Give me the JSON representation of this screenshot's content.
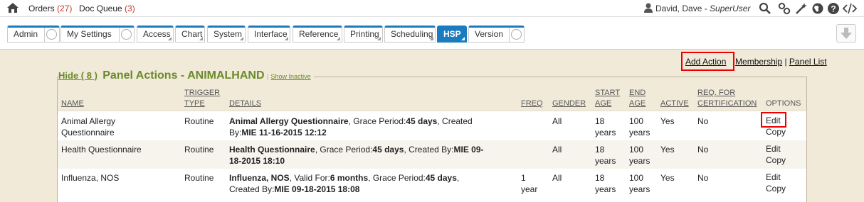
{
  "topbar": {
    "orders_label": "Orders",
    "orders_count": "(27)",
    "doc_queue_label": "Doc Queue",
    "doc_queue_count": "(3)",
    "user_name": "David, Dave",
    "user_role": "SuperUser",
    "icons": [
      "home-icon",
      "user-icon",
      "search-icon",
      "link-icon",
      "magic-wand-icon",
      "globe-icon",
      "help-icon",
      "code-icon"
    ]
  },
  "tabs": [
    {
      "label": "Admin"
    },
    {
      "label": "My Settings"
    },
    {
      "label": "Access"
    },
    {
      "label": "Chart"
    },
    {
      "label": "System"
    },
    {
      "label": "Interface"
    },
    {
      "label": "Reference"
    },
    {
      "label": "Printing"
    },
    {
      "label": "Scheduling"
    },
    {
      "label": "HSP"
    },
    {
      "label": "Version"
    }
  ],
  "actions": {
    "add_action": "Add Action",
    "membership": "Membership",
    "separator": "|",
    "panel_list": "Panel List"
  },
  "panel": {
    "hide_label": "Hide ( 8 )",
    "title": "Panel Actions - ANIMALHAND",
    "divider": "|",
    "show_inactive": "Show Inactive"
  },
  "columns": {
    "name": "NAME",
    "trigger_1": "TRIGGER",
    "trigger_2": "TYPE",
    "details": "DETAILS",
    "freq": "FREQ",
    "gender": "GENDER",
    "start_1": "START",
    "start_2": "AGE",
    "end_1": "END",
    "end_2": "AGE",
    "active": "ACTIVE",
    "req_1": "REQ. FOR",
    "req_2": "CERTIFICATION",
    "options": "OPTIONS"
  },
  "rows": [
    {
      "name_1": "Animal Allergy",
      "name_2": "Questionnaire",
      "trigger": "Routine",
      "d_title": "Animal Allergy Questionnaire",
      "d_text1": ", Grace Period:",
      "d_val1": "45 days",
      "d_text2": ", Created",
      "d_line2_pre": "By:",
      "d_created": "MIE 11-16-2015 12:12",
      "freq_1": "",
      "freq_2": "",
      "gender": "All",
      "start_1": "18",
      "start_2": "years",
      "end_1": "100",
      "end_2": "years",
      "active": "Yes",
      "req": "No",
      "edit": "Edit",
      "copy": "Copy"
    },
    {
      "name_1": "Health Questionnaire",
      "name_2": "",
      "trigger": "Routine",
      "d_title": "Health Questionnaire",
      "d_text1": ", Grace Period:",
      "d_val1": "45 days",
      "d_text2": ", Created By:",
      "d_created_a": "MIE 09-",
      "d_created_b": "18-2015 18:10",
      "freq_1": "",
      "freq_2": "",
      "gender": "All",
      "start_1": "18",
      "start_2": "years",
      "end_1": "100",
      "end_2": "years",
      "active": "Yes",
      "req": "No",
      "edit": "Edit",
      "copy": "Copy"
    },
    {
      "name_1": "Influenza, NOS",
      "name_2": "",
      "trigger": "Routine",
      "d_title": "Influenza, NOS",
      "d_text1": ", Valid For:",
      "d_val1": "6 months",
      "d_text2": ", Grace Period:",
      "d_val2": "45 days",
      "d_text3": ",",
      "d_line2_pre": "Created By:",
      "d_created": "MIE 09-18-2015 18:08",
      "freq_1": "1",
      "freq_2": "year",
      "gender": "All",
      "start_1": "18",
      "start_2": "years",
      "end_1": "100",
      "end_2": "years",
      "active": "Yes",
      "req": "No",
      "edit": "Edit",
      "copy": "Copy"
    }
  ],
  "colors": {
    "accent": "#1a7bbf",
    "panel_green": "#6a8a2a",
    "highlight_red": "#ee0000",
    "count_red": "#c0392b",
    "background": "#f1ead9"
  }
}
